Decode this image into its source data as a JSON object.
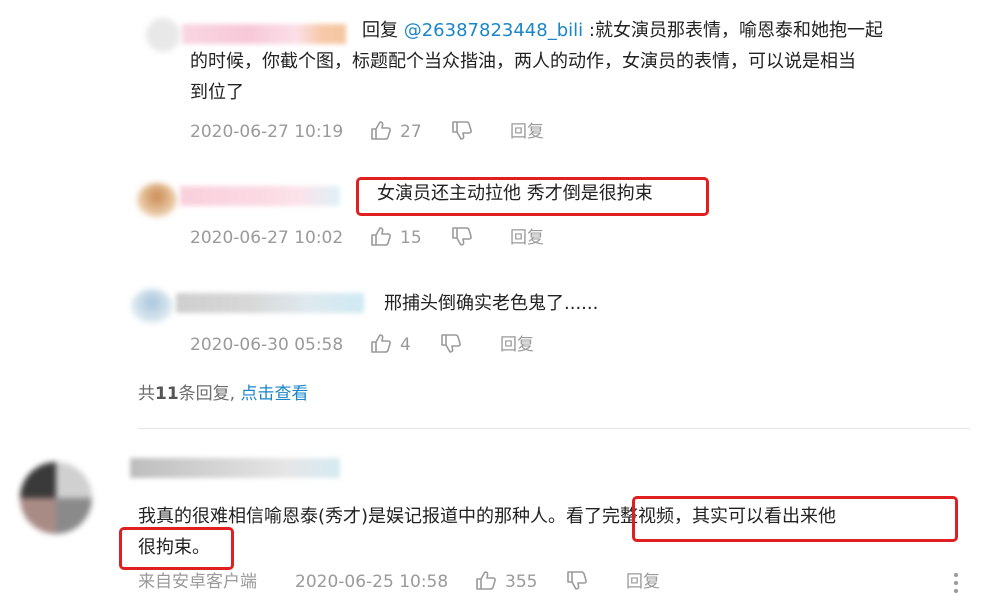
{
  "replies": [
    {
      "reply_prefix": "回复",
      "reply_target": "@26387823448_bili",
      "text_line1": ":就女演员那表情，喻恩泰和她抱一起",
      "text_line2": "的时候，你截个图，标题配个当众揩油，两人的动作，女演员的表情，可以说是相当",
      "text_line3": "到位了",
      "time": "2020-06-27 10:19",
      "likes": "27",
      "reply_label": "回复"
    },
    {
      "text": "女演员还主动拉他 秀才倒是很拘束",
      "time": "2020-06-27 10:02",
      "likes": "15",
      "reply_label": "回复"
    },
    {
      "text": "邢捕头倒确实老色鬼了......",
      "time": "2020-06-30 05:58",
      "likes": "4",
      "reply_label": "回复"
    }
  ],
  "reply_summary": {
    "prefix": "共",
    "count": "11",
    "suffix": "条回复,",
    "view_link": "点击查看"
  },
  "main_comment": {
    "text_part1": "我真的很难相信喻恩泰(秀才)是娱记报道中的那种人。",
    "text_part2": "看了完整视频，其实可以看出来他",
    "text_line2": "很拘束。",
    "source": "来自安卓客户端",
    "time": "2020-06-25 10:58",
    "likes": "355",
    "reply_label": "回复"
  },
  "colors": {
    "highlight_box": "#e02020",
    "link": "#1a86c8",
    "meta_text": "#9a9a9a"
  },
  "icons": [
    "thumbs-up-icon",
    "thumbs-down-icon",
    "more-vertical-icon"
  ]
}
